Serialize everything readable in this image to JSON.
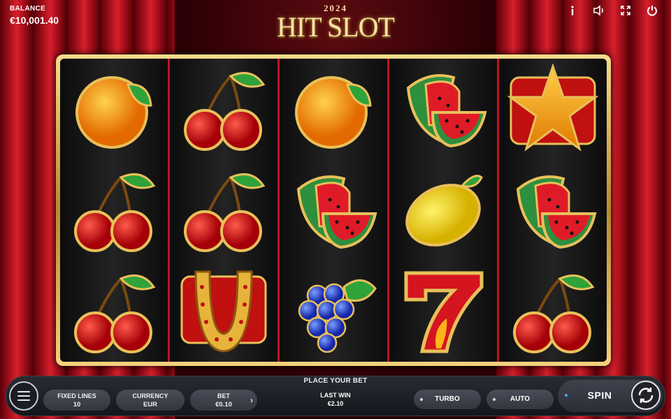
{
  "balance": {
    "label": "BALANCE",
    "value": "€10,001.40"
  },
  "logo": {
    "year": "2024",
    "name": "HIT SLOT"
  },
  "top_icons": [
    "info-icon",
    "sound-icon",
    "fullscreen-icon",
    "power-icon"
  ],
  "reels": [
    [
      "orange",
      "cherry",
      "cherry"
    ],
    [
      "cherry",
      "cherry",
      "horseshoe"
    ],
    [
      "orange",
      "watermelon",
      "grapes"
    ],
    [
      "watermelon",
      "lemon",
      "seven"
    ],
    [
      "star",
      "watermelon",
      "cherry"
    ]
  ],
  "bottom_bar": {
    "place_bet": "PLACE YOUR BET",
    "fixed_lines": {
      "label": "FIXED LINES",
      "value": "10"
    },
    "currency": {
      "label": "CURRENCY",
      "value": "EUR"
    },
    "bet": {
      "label": "BET",
      "value": "€0.10"
    },
    "last_win": {
      "label": "LAST WIN",
      "value": "€2.10"
    },
    "turbo_label": "TURBO",
    "auto_label": "AUTO",
    "spin_label": "SPIN"
  },
  "colors": {
    "curtain_red": "#c51a26",
    "frame_gold": "#d9b35c",
    "reel_bg": "#141414",
    "bar_bg": "#23252d"
  }
}
